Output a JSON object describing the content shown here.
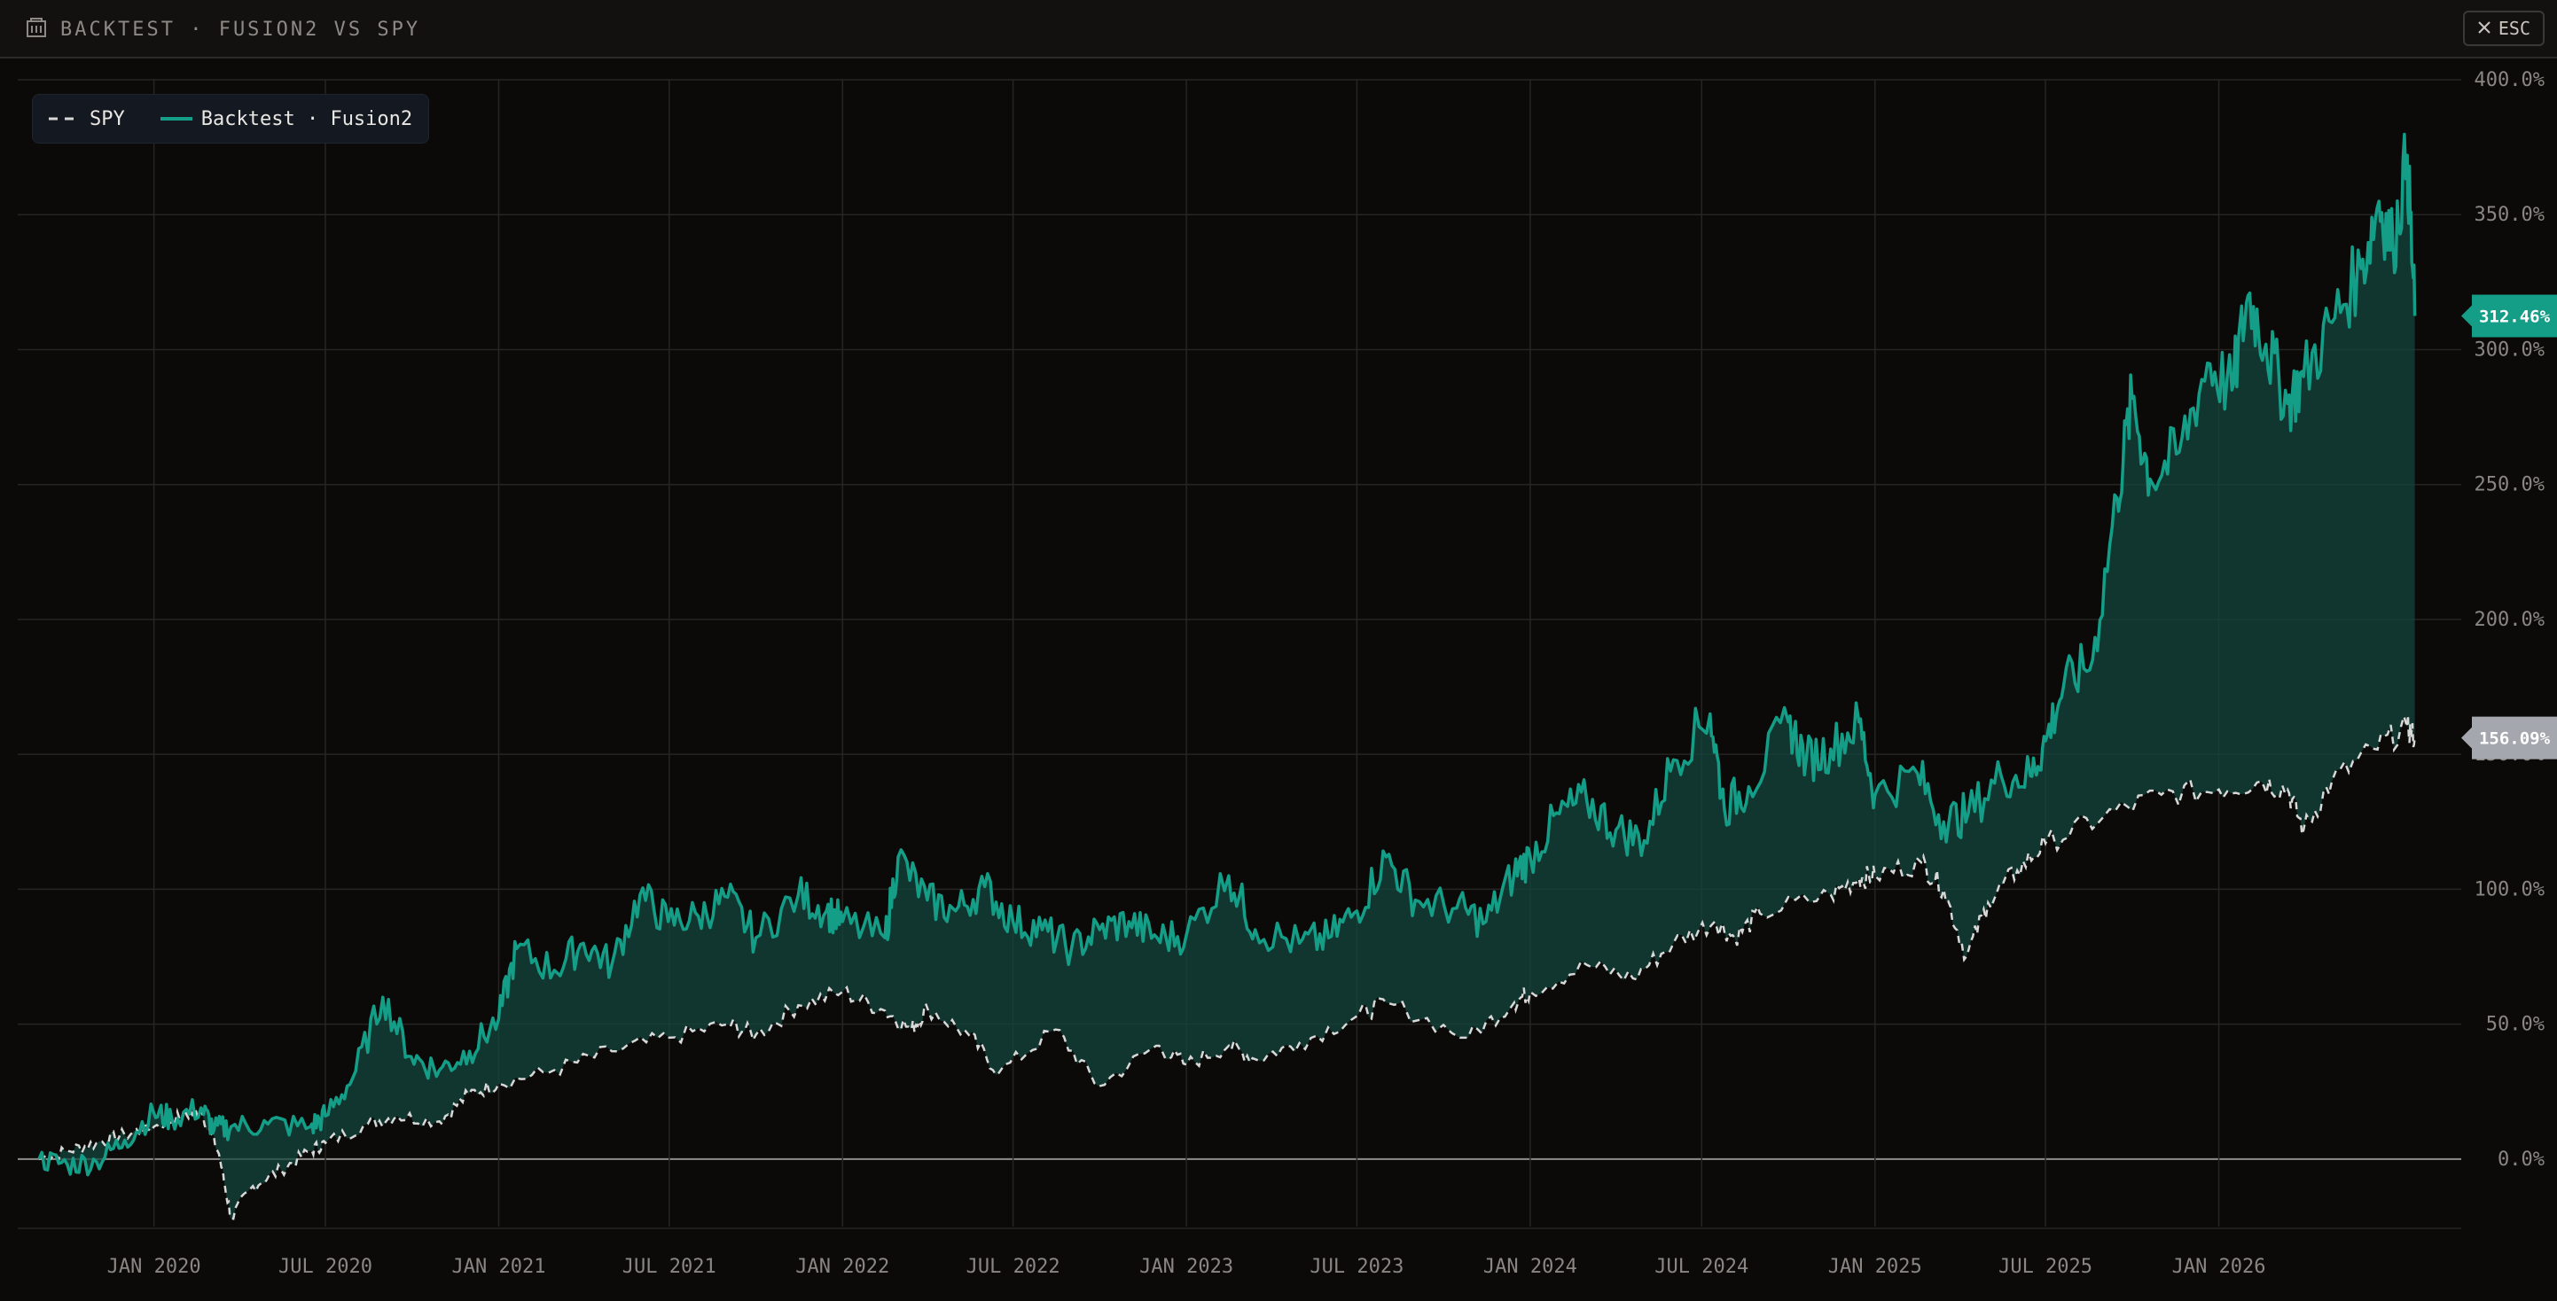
{
  "window": {
    "title": "BACKTEST · FUSION2 VS SPY",
    "esc_label": "ESC",
    "title_icon": "building-icon",
    "close_icon": "close-icon"
  },
  "legend": {
    "spy_label": "SPY",
    "strategy_label": "Backtest · Fusion2"
  },
  "colors": {
    "background": "#0b0a09",
    "strategy_line": "#149e87",
    "strategy_fill": "#13463c",
    "spy_line": "#d8d8d8",
    "spy_badge": "#a4a7ad",
    "grid": "#262523",
    "zero_line": "#8f8e8b"
  },
  "chart_data": {
    "type": "line",
    "title": "",
    "xlabel": "",
    "ylabel": "",
    "x_range": [
      "2019-09-01",
      "2026-08-20"
    ],
    "ylim": [
      -25,
      400
    ],
    "y_ticks": [
      0,
      50,
      100,
      150,
      200,
      250,
      300,
      350,
      400
    ],
    "y_tick_labels": [
      "0.0%",
      "50.0%",
      "100.0%",
      "150.0%",
      "200.0%",
      "250.0%",
      "300.0%",
      "350.0%",
      "400.0%"
    ],
    "x_ticks": [
      "2020-01-01",
      "2020-07-01",
      "2021-01-01",
      "2021-07-01",
      "2022-01-01",
      "2022-07-01",
      "2023-01-01",
      "2023-07-01",
      "2024-01-01",
      "2024-07-01",
      "2025-01-01",
      "2025-07-01",
      "2026-01-01"
    ],
    "x_tick_labels": [
      "JAN 2020",
      "JUL 2020",
      "JAN 2021",
      "JUL 2021",
      "JAN 2022",
      "JUL 2022",
      "JAN 2023",
      "JUL 2023",
      "JAN 2024",
      "JUL 2024",
      "JAN 2025",
      "JUL 2025",
      "JAN 2026"
    ],
    "grid": true,
    "legend_position": "top-left",
    "last_values": {
      "strategy": "312.46%",
      "spy": "156.09%"
    },
    "series": [
      {
        "name": "SPY",
        "style": "dashed",
        "points": [
          [
            "2019-09-01",
            0
          ],
          [
            "2019-10-01",
            3
          ],
          [
            "2019-11-01",
            6
          ],
          [
            "2019-12-01",
            9
          ],
          [
            "2020-01-01",
            12
          ],
          [
            "2020-02-01",
            16
          ],
          [
            "2020-02-20",
            18
          ],
          [
            "2020-03-10",
            2
          ],
          [
            "2020-03-23",
            -22
          ],
          [
            "2020-04-15",
            -10
          ],
          [
            "2020-05-15",
            -4
          ],
          [
            "2020-06-15",
            3
          ],
          [
            "2020-07-01",
            6
          ],
          [
            "2020-08-15",
            13
          ],
          [
            "2020-09-15",
            16
          ],
          [
            "2020-10-30",
            14
          ],
          [
            "2020-11-30",
            24
          ],
          [
            "2021-01-01",
            28
          ],
          [
            "2021-03-01",
            33
          ],
          [
            "2021-05-01",
            40
          ],
          [
            "2021-07-01",
            45
          ],
          [
            "2021-09-01",
            50
          ],
          [
            "2021-10-01",
            46
          ],
          [
            "2021-11-15",
            57
          ],
          [
            "2022-01-01",
            62
          ],
          [
            "2022-02-15",
            55
          ],
          [
            "2022-03-15",
            48
          ],
          [
            "2022-04-01",
            56
          ],
          [
            "2022-05-15",
            46
          ],
          [
            "2022-06-16",
            32
          ],
          [
            "2022-08-15",
            48
          ],
          [
            "2022-09-30",
            27
          ],
          [
            "2022-11-30",
            42
          ],
          [
            "2023-01-01",
            35
          ],
          [
            "2023-02-15",
            42
          ],
          [
            "2023-03-15",
            37
          ],
          [
            "2023-05-01",
            43
          ],
          [
            "2023-07-01",
            53
          ],
          [
            "2023-08-01",
            58
          ],
          [
            "2023-10-27",
            45
          ],
          [
            "2023-12-15",
            58
          ],
          [
            "2024-01-01",
            62
          ],
          [
            "2024-03-01",
            72
          ],
          [
            "2024-04-19",
            67
          ],
          [
            "2024-06-01",
            80
          ],
          [
            "2024-07-15",
            88
          ],
          [
            "2024-08-05",
            82
          ],
          [
            "2024-09-01",
            91
          ],
          [
            "2024-11-15",
            98
          ],
          [
            "2024-12-15",
            104
          ],
          [
            "2025-01-01",
            105
          ],
          [
            "2025-02-19",
            110
          ],
          [
            "2025-03-15",
            100
          ],
          [
            "2025-04-08",
            75
          ],
          [
            "2025-05-01",
            95
          ],
          [
            "2025-06-01",
            107
          ],
          [
            "2025-07-01",
            117
          ],
          [
            "2025-09-01",
            127
          ],
          [
            "2025-11-01",
            135
          ],
          [
            "2026-01-01",
            137
          ],
          [
            "2026-02-15",
            140
          ],
          [
            "2026-03-15",
            137
          ],
          [
            "2026-04-01",
            122
          ],
          [
            "2026-05-01",
            140
          ],
          [
            "2026-06-15",
            152
          ],
          [
            "2026-07-20",
            160
          ],
          [
            "2026-07-28",
            156.09
          ]
        ]
      },
      {
        "name": "Backtest · Fusion2",
        "style": "solid",
        "points": [
          [
            "2019-09-01",
            0
          ],
          [
            "2019-10-01",
            -2
          ],
          [
            "2019-11-01",
            -1
          ],
          [
            "2019-12-01",
            7
          ],
          [
            "2020-01-01",
            17
          ],
          [
            "2020-01-20",
            15
          ],
          [
            "2020-02-20",
            19
          ],
          [
            "2020-03-05",
            11
          ],
          [
            "2020-03-23",
            12
          ],
          [
            "2020-05-01",
            13
          ],
          [
            "2020-06-15",
            12
          ],
          [
            "2020-07-01",
            16
          ],
          [
            "2020-07-30",
            30
          ],
          [
            "2020-08-31",
            60
          ],
          [
            "2020-09-30",
            38
          ],
          [
            "2020-10-30",
            33
          ],
          [
            "2020-12-01",
            40
          ],
          [
            "2021-01-01",
            52
          ],
          [
            "2021-01-20",
            78
          ],
          [
            "2021-03-01",
            70
          ],
          [
            "2021-04-01",
            80
          ],
          [
            "2021-05-01",
            72
          ],
          [
            "2021-05-31",
            98
          ],
          [
            "2021-06-30",
            88
          ],
          [
            "2021-08-01",
            90
          ],
          [
            "2021-09-01",
            97
          ],
          [
            "2021-10-01",
            82
          ],
          [
            "2021-11-15",
            98
          ],
          [
            "2021-12-15",
            92
          ],
          [
            "2022-01-01",
            88
          ],
          [
            "2022-02-15",
            82
          ],
          [
            "2022-03-01",
            112
          ],
          [
            "2022-04-01",
            96
          ],
          [
            "2022-05-01",
            92
          ],
          [
            "2022-06-01",
            101
          ],
          [
            "2022-07-01",
            88
          ],
          [
            "2022-08-01",
            85
          ],
          [
            "2022-09-01",
            78
          ],
          [
            "2022-10-01",
            85
          ],
          [
            "2022-11-01",
            88
          ],
          [
            "2022-12-01",
            82
          ],
          [
            "2023-01-01",
            83
          ],
          [
            "2023-02-15",
            105
          ],
          [
            "2023-03-15",
            85
          ],
          [
            "2023-05-01",
            80
          ],
          [
            "2023-06-01",
            82
          ],
          [
            "2023-07-01",
            92
          ],
          [
            "2023-08-01",
            112
          ],
          [
            "2023-09-01",
            96
          ],
          [
            "2023-10-15",
            93
          ],
          [
            "2023-11-15",
            88
          ],
          [
            "2023-12-15",
            106
          ],
          [
            "2024-01-01",
            112
          ],
          [
            "2024-02-01",
            128
          ],
          [
            "2024-03-01",
            133
          ],
          [
            "2024-04-01",
            122
          ],
          [
            "2024-05-01",
            118
          ],
          [
            "2024-06-01",
            148
          ],
          [
            "2024-07-10",
            165
          ],
          [
            "2024-07-25",
            130
          ],
          [
            "2024-08-20",
            138
          ],
          [
            "2024-10-01",
            162
          ],
          [
            "2024-10-20",
            148
          ],
          [
            "2024-11-15",
            152
          ],
          [
            "2024-12-15",
            162
          ],
          [
            "2025-01-01",
            135
          ],
          [
            "2025-02-15",
            143
          ],
          [
            "2025-03-15",
            125
          ],
          [
            "2025-04-10",
            128
          ],
          [
            "2025-05-15",
            142
          ],
          [
            "2025-06-15",
            142
          ],
          [
            "2025-07-01",
            155
          ],
          [
            "2025-07-20",
            175
          ],
          [
            "2025-08-20",
            185
          ],
          [
            "2025-09-15",
            245
          ],
          [
            "2025-10-01",
            282
          ],
          [
            "2025-10-20",
            252
          ],
          [
            "2025-11-20",
            262
          ],
          [
            "2025-12-20",
            295
          ],
          [
            "2026-01-15",
            285
          ],
          [
            "2026-02-01",
            320
          ],
          [
            "2026-02-20",
            302
          ],
          [
            "2026-03-15",
            280
          ],
          [
            "2026-04-01",
            290
          ],
          [
            "2026-05-01",
            310
          ],
          [
            "2026-06-01",
            330
          ],
          [
            "2026-06-20",
            355
          ],
          [
            "2026-07-05",
            338
          ],
          [
            "2026-07-20",
            372
          ],
          [
            "2026-07-28",
            312.46
          ]
        ]
      }
    ]
  }
}
